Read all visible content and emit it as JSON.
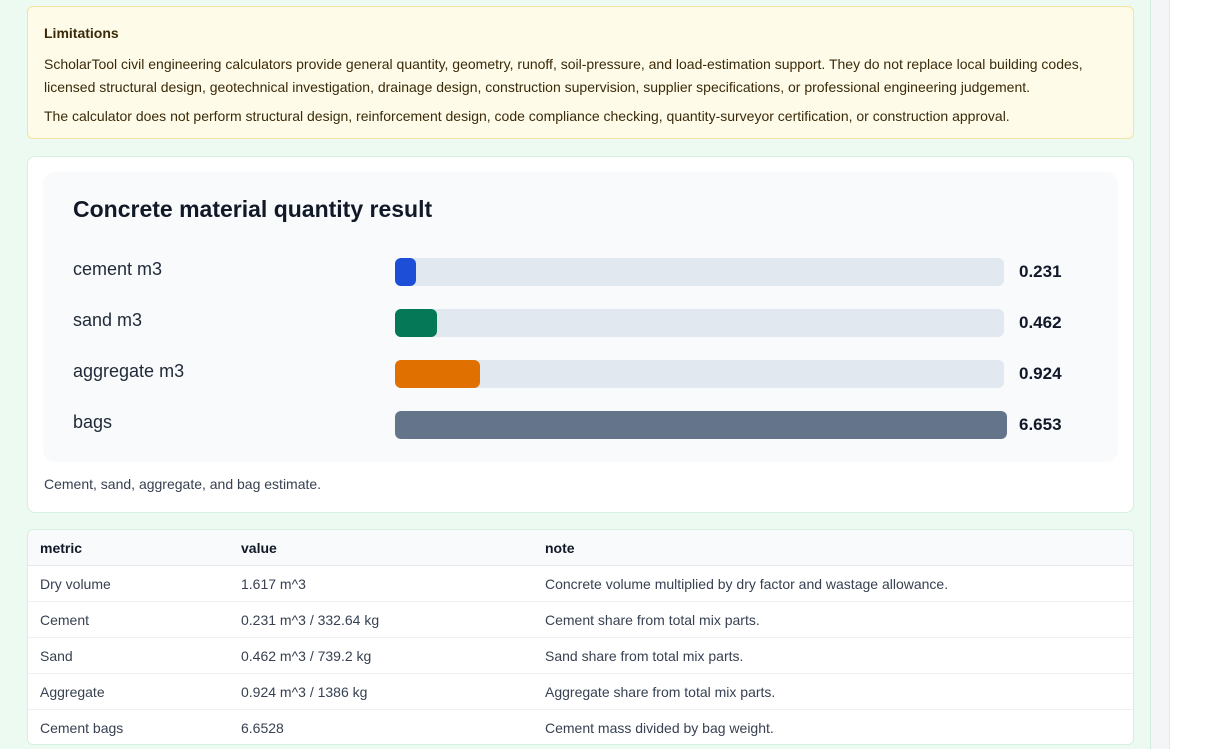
{
  "limitations": {
    "title": "Limitations",
    "paragraphs": [
      "ScholarTool civil engineering calculators provide general quantity, geometry, runoff, soil-pressure, and load-estimation support. They do not replace local building codes, licensed structural design, geotechnical investigation, drainage design, construction supervision, supplier specifications, or professional engineering judgement.",
      "The calculator does not perform structural design, reinforcement design, code compliance checking, quantity-surveyor certification, or construction approval."
    ]
  },
  "result": {
    "title": "Concrete material quantity result",
    "caption": "Cement, sand, aggregate, and bag estimate."
  },
  "chart_data": {
    "type": "bar",
    "orientation": "horizontal",
    "title": "Concrete material quantity result",
    "categories": [
      "cement m3",
      "sand m3",
      "aggregate m3",
      "bags"
    ],
    "values": [
      0.231,
      0.462,
      0.924,
      6.653
    ],
    "value_labels": [
      "0.231",
      "0.462",
      "0.924",
      "6.653"
    ],
    "colors": [
      "#1d4ed8",
      "#047857",
      "#e07000",
      "#64748b"
    ],
    "xlim": [
      0,
      6.653
    ]
  },
  "table": {
    "headers": [
      "metric",
      "value",
      "note"
    ],
    "rows": [
      [
        "Dry volume",
        "1.617 m^3",
        "Concrete volume multiplied by dry factor and wastage allowance."
      ],
      [
        "Cement",
        "0.231 m^3 / 332.64 kg",
        "Cement share from total mix parts."
      ],
      [
        "Sand",
        "0.462 m^3 / 739.2 kg",
        "Sand share from total mix parts."
      ],
      [
        "Aggregate",
        "0.924 m^3 / 1386 kg",
        "Aggregate share from total mix parts."
      ],
      [
        "Cement bags",
        "6.6528",
        "Cement mass divided by bag weight."
      ]
    ]
  }
}
